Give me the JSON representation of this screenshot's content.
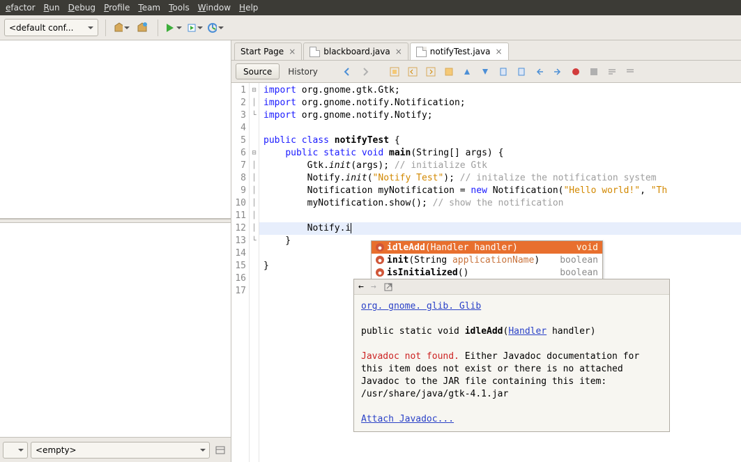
{
  "menubar": [
    "efactor",
    "Run",
    "Debug",
    "Profile",
    "Team",
    "Tools",
    "Window",
    "Help"
  ],
  "config_selector": "<default conf...",
  "tabs": [
    {
      "label": "Start Page",
      "active": false,
      "icon": "none"
    },
    {
      "label": "blackboard.java",
      "active": false,
      "icon": "java"
    },
    {
      "label": "notifyTest.java",
      "active": true,
      "icon": "java"
    }
  ],
  "subtool": {
    "source": "Source",
    "history": "History"
  },
  "left_bottom_combo": "<empty>",
  "code": {
    "lines": [
      {
        "n": 1,
        "fold": "⊟",
        "html": "<span class='kw'>import</span> org.gnome.gtk.Gtk;"
      },
      {
        "n": 2,
        "fold": "│",
        "html": "<span class='kw'>import</span> org.gnome.notify.Notification;"
      },
      {
        "n": 3,
        "fold": "└",
        "html": "<span class='kw'>import</span> org.gnome.notify.Notify;"
      },
      {
        "n": 4,
        "fold": "",
        "html": ""
      },
      {
        "n": 5,
        "fold": "",
        "html": "<span class='kw'>public class</span> <span class='bold'>notifyTest</span> {"
      },
      {
        "n": 6,
        "fold": "⊟",
        "html": "    <span class='kw'>public static</span> <span class='kw'>void</span> <span class='bold'>main</span>(String[] args) {"
      },
      {
        "n": 7,
        "fold": "│",
        "html": "        Gtk.<span style='font-style:italic'>init</span>(args); <span class='cm'>// initialize Gtk</span>"
      },
      {
        "n": 8,
        "fold": "│",
        "html": "        Notify.<span style='font-style:italic'>init</span>(<span class='str'>\"Notify Test\"</span>); <span class='cm'>// initalize the notification system</span>"
      },
      {
        "n": 9,
        "fold": "│",
        "html": "        Notification myNotification = <span class='kw'>new</span> Notification(<span class='str'>\"Hello world!\"</span>, <span class='str'>\"Th</span>"
      },
      {
        "n": 10,
        "fold": "│",
        "html": "        myNotification.show(); <span class='cm'>// show the notification</span>"
      },
      {
        "n": 11,
        "fold": "│",
        "html": ""
      },
      {
        "n": 12,
        "fold": "│",
        "html": "        Notify.i<span class='caret'></span>",
        "hl": true
      },
      {
        "n": 13,
        "fold": "└",
        "html": "    }"
      },
      {
        "n": 14,
        "fold": "",
        "html": ""
      },
      {
        "n": 15,
        "fold": "",
        "html": "}"
      },
      {
        "n": 16,
        "fold": "",
        "html": ""
      },
      {
        "n": 17,
        "fold": "",
        "html": ""
      }
    ]
  },
  "completion": [
    {
      "name": "idleAdd",
      "params": "Handler handler",
      "ret": "void",
      "sel": true
    },
    {
      "name": "init",
      "params": "String applicationName",
      "ret": "boolean",
      "sel": false
    },
    {
      "name": "isInitialized",
      "params": "",
      "ret": "boolean",
      "sel": false
    }
  ],
  "doc": {
    "package": "org. gnome. glib. Glib",
    "sig_pre": "public static void ",
    "sig_name": "idleAdd",
    "sig_param_type": "Handler",
    "sig_param_name": " handler)",
    "notfound": "Javadoc not found.",
    "body": " Either Javadoc documentation for this item does not exist or there is no attached Javadoc to the JAR file containing this item: /usr/share/java/gtk-4.1.jar",
    "attach": "Attach Javadoc..."
  }
}
